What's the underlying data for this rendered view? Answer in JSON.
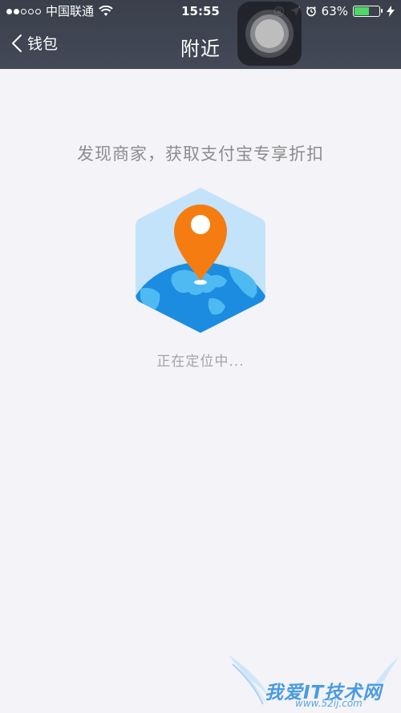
{
  "status_bar": {
    "carrier": "中国联通",
    "time": "15:55",
    "battery": "63%",
    "battery_level": 0.63
  },
  "nav": {
    "back_label": "钱包",
    "title": "附近"
  },
  "main": {
    "headline": "发现商家，获取支付宝专享折扣",
    "status": "正在定位中..."
  },
  "watermark": {
    "text": "我爱IT技术网",
    "url": "www.52ij.com"
  },
  "colors": {
    "nav_bg": "#3f4451",
    "page_bg": "#f4f3f8",
    "pin": "#f57c10",
    "globe": "#1e8fe3",
    "hex": "#bfe1fa"
  }
}
